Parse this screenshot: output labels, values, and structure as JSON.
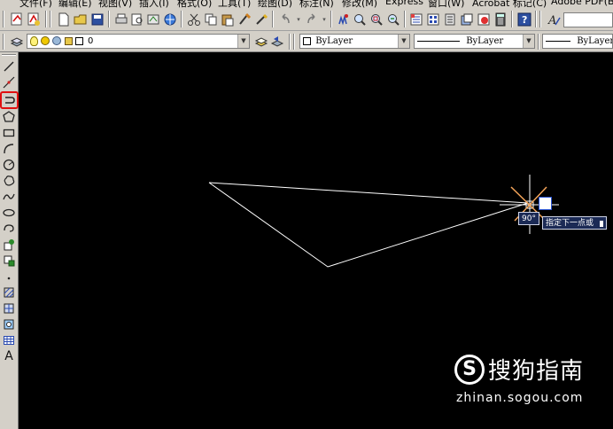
{
  "menu": {
    "items": [
      "文件(F)",
      "编辑(E)",
      "视图(V)",
      "插入(I)",
      "格式(O)",
      "工具(T)",
      "绘图(D)",
      "标注(N)",
      "修改(M)",
      "Express",
      "窗口(W)",
      "Acrobat 标记(C)",
      "Adobe PDF(B)"
    ]
  },
  "layer_toolbar": {
    "layer_value": "0",
    "color_value": "ByLayer",
    "linetype_value": "ByLayer",
    "lineweight_value": "ByLayer"
  },
  "draw_toolbar": {
    "active_tool": "polyline",
    "text_tool_glyph": "A"
  },
  "drawing": {
    "background_color": "#000000",
    "line_color": "#ffffff",
    "cursor_color": "#ffffff",
    "tracking_color": "#f5a55a"
  },
  "dynamic_input": {
    "angle_label": "90°",
    "prompt": "指定下一点或"
  },
  "watermark": {
    "brand": "搜狗指南",
    "url": "zhinan.sogou.com"
  },
  "colors": {
    "highlight_border": "#e01010",
    "tooltip_bg": "#1b2a55"
  }
}
